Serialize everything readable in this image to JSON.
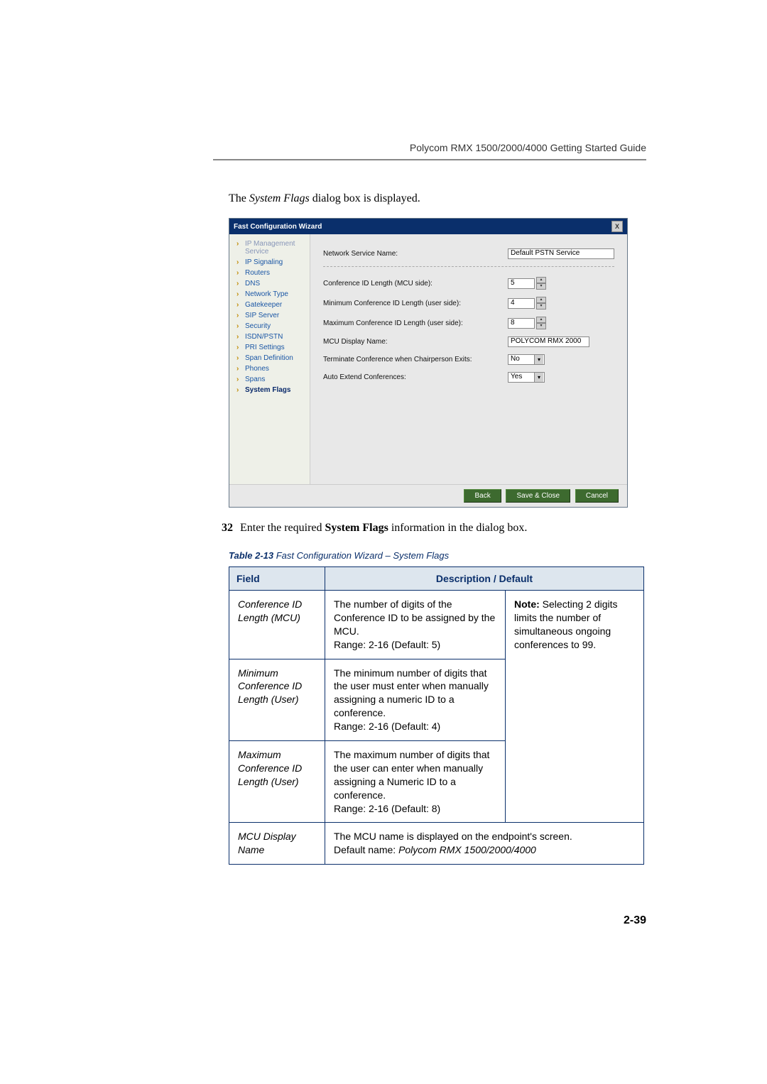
{
  "header": "Polycom RMX 1500/2000/4000 Getting Started Guide",
  "intro": {
    "prefix": "The ",
    "italic": "System Flags",
    "suffix": " dialog box is displayed."
  },
  "dialog": {
    "title": "Fast Configuration Wizard",
    "close": "X",
    "nav": [
      {
        "label": "IP Management Service",
        "dim": true
      },
      {
        "label": "IP Signaling",
        "dim": false
      },
      {
        "label": "Routers",
        "dim": false
      },
      {
        "label": "DNS",
        "dim": false
      },
      {
        "label": "Network Type",
        "dim": false
      },
      {
        "label": "Gatekeeper",
        "dim": false
      },
      {
        "label": "SIP Server",
        "dim": false
      },
      {
        "label": "Security",
        "dim": false
      },
      {
        "label": "ISDN/PSTN",
        "dim": false
      },
      {
        "label": "PRI Settings",
        "dim": false
      },
      {
        "label": "Span Definition",
        "dim": false
      },
      {
        "label": "Phones",
        "dim": false
      },
      {
        "label": "Spans",
        "dim": false
      },
      {
        "label": "System Flags",
        "dim": false,
        "active": true
      }
    ],
    "fields": {
      "svc_label": "Network Service Name:",
      "svc_val": "Default PSTN Service",
      "conf_len_label": "Conference ID Length (MCU side):",
      "conf_len_val": "5",
      "min_len_label": "Minimum Conference ID Length (user side):",
      "min_len_val": "4",
      "max_len_label": "Maximum Conference ID Length (user side):",
      "max_len_val": "8",
      "mcu_disp_label": "MCU Display Name:",
      "mcu_disp_val": "POLYCOM RMX 2000",
      "term_label": "Terminate Conference when Chairperson Exits:",
      "term_val": "No",
      "auto_label": "Auto Extend Conferences:",
      "auto_val": "Yes"
    },
    "buttons": {
      "back": "Back",
      "save": "Save & Close",
      "cancel": "Cancel"
    }
  },
  "step": {
    "num": "32",
    "pre": "Enter the required ",
    "bold": "System Flags",
    "post": " information in the dialog box."
  },
  "table_caption": {
    "bold": "Table 2-13",
    "rest": "  Fast Configuration Wizard – System Flags"
  },
  "table": {
    "h1": "Field",
    "h2": "Description / Default",
    "rows": [
      {
        "field": "Conference ID Length (MCU)",
        "desc": "The number of digits of the Conference ID to be assigned by the MCU.\nRange: 2-16 (Default: 5)"
      },
      {
        "field": "Minimum Conference ID Length (User)",
        "desc": "The minimum number of digits that the user must enter when manually assigning a numeric ID to a conference.\nRange: 2-16 (Default: 4)"
      },
      {
        "field": "Maximum Conference ID Length (User)",
        "desc": "The maximum number of digits that the user can enter when manually assigning a Numeric ID to a conference.\nRange: 2-16 (Default: 8)"
      }
    ],
    "note": {
      "bold": "Note:",
      "rest": " Selecting 2 digits limits the number of simultaneous ongoing conferences to 99."
    },
    "row4": {
      "field": "MCU Display Name",
      "desc_pre": "The MCU name is displayed on the endpoint's screen.\nDefault name: ",
      "desc_ital": "Polycom RMX 1500/2000/4000"
    }
  },
  "page_num": "2-39"
}
